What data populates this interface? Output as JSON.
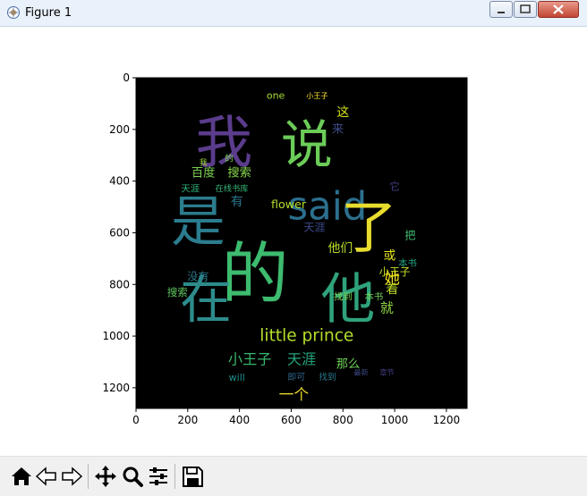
{
  "window": {
    "title": "Figure 1"
  },
  "toolbar": {
    "buttons": [
      {
        "name": "home-icon"
      },
      {
        "name": "back-icon"
      },
      {
        "name": "forward-icon"
      },
      {
        "name": "pan-icon"
      },
      {
        "name": "zoom-icon"
      },
      {
        "name": "subplots-icon"
      },
      {
        "name": "save-icon"
      }
    ]
  },
  "chart_data": {
    "type": "image",
    "xlim": [
      0,
      1280
    ],
    "ylim_inverted": [
      1280,
      0
    ],
    "xticks": [
      "0",
      "200",
      "400",
      "600",
      "800",
      "1000",
      "1200"
    ],
    "yticks": [
      "0",
      "200",
      "400",
      "600",
      "800",
      "1000",
      "1200"
    ],
    "words": [
      {
        "text": "我",
        "x": 340,
        "y": 250,
        "fs": 220,
        "c": "#5b3c8c"
      },
      {
        "text": "的",
        "x": 460,
        "y": 760,
        "fs": 260,
        "c": "#3dbb6f"
      },
      {
        "text": "是",
        "x": 240,
        "y": 560,
        "fs": 210,
        "c": "#2b7c8e"
      },
      {
        "text": "在",
        "x": 270,
        "y": 860,
        "fs": 200,
        "c": "#2d8c8b"
      },
      {
        "text": "他",
        "x": 820,
        "y": 860,
        "fs": 210,
        "c": "#2fa37a"
      },
      {
        "text": "说",
        "x": 660,
        "y": 260,
        "fs": 200,
        "c": "#6ccc58"
      },
      {
        "text": "said",
        "x": 740,
        "y": 500,
        "fs": 150,
        "c": "#2c6f8e"
      },
      {
        "text": "了",
        "x": 900,
        "y": 580,
        "fs": 220,
        "c": "#e8dd2e"
      },
      {
        "text": "little prince",
        "x": 660,
        "y": 1000,
        "fs": 64,
        "c": "#b5de2b"
      },
      {
        "text": "小王子",
        "x": 440,
        "y": 1090,
        "fs": 56,
        "c": "#3ab66d"
      },
      {
        "text": "天涯",
        "x": 640,
        "y": 1090,
        "fs": 56,
        "c": "#26a37c"
      },
      {
        "text": "一个",
        "x": 610,
        "y": 1225,
        "fs": 58,
        "c": "#e6d52a"
      },
      {
        "text": "百度",
        "x": 260,
        "y": 370,
        "fs": 46,
        "c": "#7ad151"
      },
      {
        "text": "搜索",
        "x": 400,
        "y": 370,
        "fs": 46,
        "c": "#84d44b"
      },
      {
        "text": "flower",
        "x": 590,
        "y": 490,
        "fs": 44,
        "c": "#b5de2b"
      },
      {
        "text": "天涯",
        "x": 690,
        "y": 580,
        "fs": 42,
        "c": "#3e4a89"
      },
      {
        "text": "他们",
        "x": 790,
        "y": 660,
        "fs": 48,
        "c": "#b8de29"
      },
      {
        "text": "小王子",
        "x": 1000,
        "y": 750,
        "fs": 40,
        "c": "#c5e021"
      },
      {
        "text": "就",
        "x": 970,
        "y": 890,
        "fs": 52,
        "c": "#8fd744"
      },
      {
        "text": "她",
        "x": 990,
        "y": 780,
        "fs": 60,
        "c": "#f1e51d"
      },
      {
        "text": "那么",
        "x": 820,
        "y": 1110,
        "fs": 46,
        "c": "#6ece58"
      },
      {
        "text": "本书",
        "x": 1050,
        "y": 720,
        "fs": 36,
        "c": "#22a884"
      },
      {
        "text": "着",
        "x": 990,
        "y": 820,
        "fs": 48,
        "c": "#c2df23"
      },
      {
        "text": "把",
        "x": 1060,
        "y": 610,
        "fs": 42,
        "c": "#43bf71"
      },
      {
        "text": "有",
        "x": 390,
        "y": 480,
        "fs": 48,
        "c": "#2a788e"
      },
      {
        "text": "这",
        "x": 800,
        "y": 135,
        "fs": 48,
        "c": "#d5e21a"
      },
      {
        "text": "来",
        "x": 780,
        "y": 200,
        "fs": 46,
        "c": "#3e4a89"
      },
      {
        "text": "它",
        "x": 1000,
        "y": 420,
        "fs": 40,
        "c": "#433e85"
      },
      {
        "text": "one",
        "x": 540,
        "y": 70,
        "fs": 38,
        "c": "#a8db34"
      },
      {
        "text": "或",
        "x": 980,
        "y": 690,
        "fs": 48,
        "c": "#e5e419"
      },
      {
        "text": "小王子",
        "x": 700,
        "y": 70,
        "fs": 28,
        "c": "#fde725"
      },
      {
        "text": "will",
        "x": 390,
        "y": 1160,
        "fs": 38,
        "c": "#21908d"
      },
      {
        "text": "天涯",
        "x": 210,
        "y": 430,
        "fs": 36,
        "c": "#2fb47c"
      },
      {
        "text": "在线书库",
        "x": 370,
        "y": 430,
        "fs": 32,
        "c": "#35b779"
      },
      {
        "text": "我",
        "x": 260,
        "y": 330,
        "fs": 30,
        "c": "#a0da39"
      },
      {
        "text": "的",
        "x": 360,
        "y": 315,
        "fs": 34,
        "c": "#7ad151"
      },
      {
        "text": "没有",
        "x": 240,
        "y": 770,
        "fs": 42,
        "c": "#287c8e"
      },
      {
        "text": "搜索",
        "x": 160,
        "y": 830,
        "fs": 40,
        "c": "#5ec962"
      },
      {
        "text": "找到",
        "x": 800,
        "y": 850,
        "fs": 36,
        "c": "#7ad151"
      },
      {
        "text": "本书",
        "x": 920,
        "y": 850,
        "fs": 36,
        "c": "#6ece58"
      },
      {
        "text": "最新",
        "x": 870,
        "y": 1140,
        "fs": 28,
        "c": "#3e4989"
      },
      {
        "text": "章节",
        "x": 970,
        "y": 1140,
        "fs": 28,
        "c": "#433e85"
      },
      {
        "text": "即可",
        "x": 620,
        "y": 1160,
        "fs": 34,
        "c": "#31688e"
      },
      {
        "text": "找到",
        "x": 740,
        "y": 1160,
        "fs": 34,
        "c": "#2a788e"
      }
    ]
  }
}
